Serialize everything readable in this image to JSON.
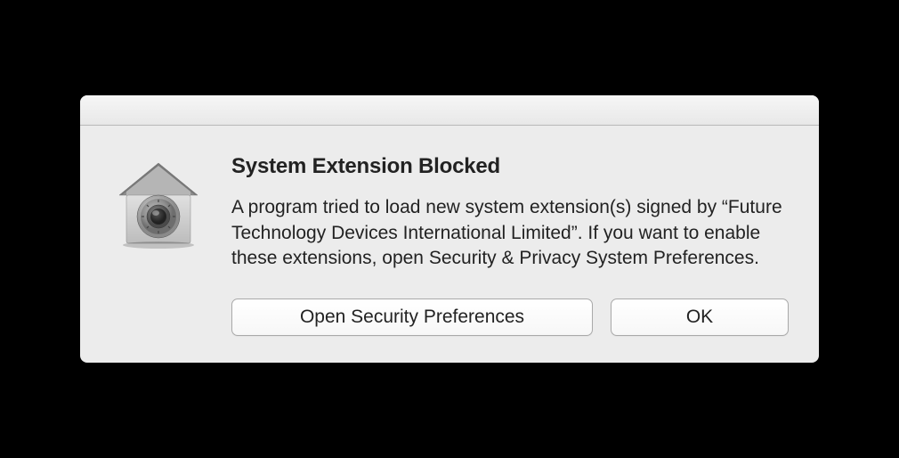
{
  "dialog": {
    "title": "System Extension Blocked",
    "message": "A program tried to load new system extension(s) signed by “Future Technology Devices International Limited”.  If you want to enable these extensions, open Security & Privacy System Preferences.",
    "primary_button": "Open Security Preferences",
    "ok_button": "OK",
    "icon": "security-house-vault-icon"
  }
}
